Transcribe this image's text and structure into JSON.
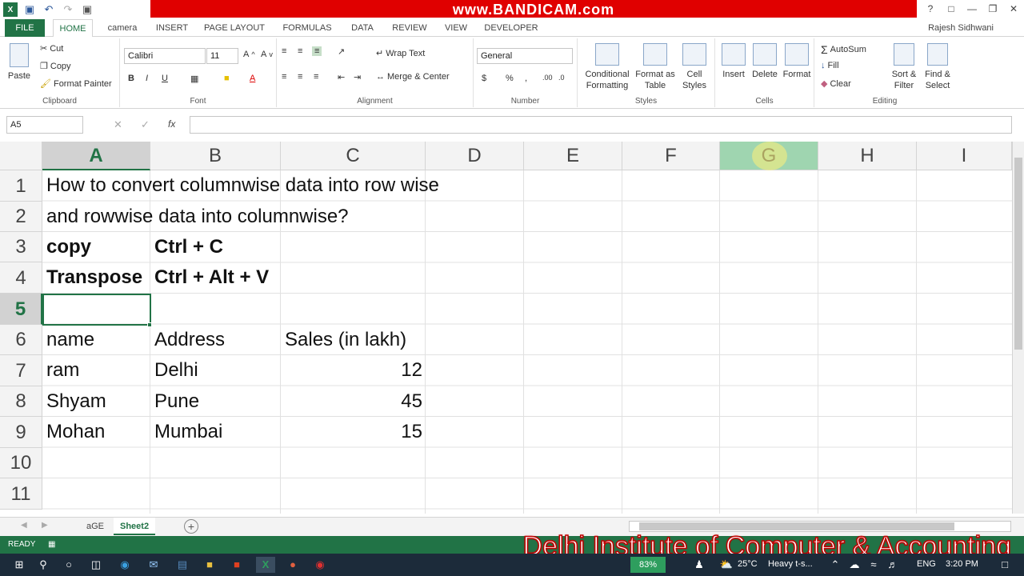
{
  "title_bar": {
    "recording_banner": "www.BANDICAM.com",
    "user": "Rajesh Sidhwani"
  },
  "tabs": [
    "FILE",
    "HOME",
    "camera",
    "INSERT",
    "PAGE LAYOUT",
    "FORMULAS",
    "DATA",
    "REVIEW",
    "VIEW",
    "DEVELOPER"
  ],
  "ribbon": {
    "clipboard": {
      "label": "Clipboard",
      "paste": "Paste",
      "cut": "Cut",
      "copy": "Copy",
      "format_painter": "Format Painter"
    },
    "font": {
      "label": "Font",
      "name": "Calibri",
      "size": "11"
    },
    "alignment": {
      "label": "Alignment",
      "wrap": "Wrap Text",
      "merge": "Merge & Center"
    },
    "number": {
      "label": "Number",
      "format": "General"
    },
    "styles": {
      "label": "Styles",
      "cond1": "Conditional",
      "cond2": "Formatting",
      "fmt1": "Format as",
      "fmt2": "Table",
      "cell1": "Cell",
      "cell2": "Styles"
    },
    "cells": {
      "label": "Cells",
      "insert": "Insert",
      "delete": "Delete",
      "format": "Format"
    },
    "editing": {
      "label": "Editing",
      "autosum": "AutoSum",
      "fill": "Fill",
      "clear": "Clear",
      "sort1": "Sort &",
      "sort2": "Filter",
      "find1": "Find &",
      "find2": "Select"
    }
  },
  "formula_bar": {
    "name_box": "A5",
    "fx": "fx",
    "content": ""
  },
  "columns": [
    "A",
    "B",
    "C",
    "D",
    "E",
    "F",
    "G",
    "H",
    "I"
  ],
  "rows": [
    "1",
    "2",
    "3",
    "4",
    "5",
    "6",
    "7",
    "8",
    "9",
    "10",
    "11"
  ],
  "cells": {
    "r1": "How to convert columnwise data into row wise",
    "r2": "and rowwise data into columnwise?",
    "a3": "copy",
    "b3": "Ctrl + C",
    "a4": "Transpose",
    "b4": "Ctrl + Alt +  V",
    "a6": "name",
    "b6": "Address",
    "c6": "Sales (in lakh)",
    "a7": "ram",
    "b7": "Delhi",
    "c7": "12",
    "a8": "Shyam",
    "b8": "Pune",
    "c8": "45",
    "a9": "Mohan",
    "b9": "Mumbai",
    "c9": "15"
  },
  "sheet_tabs": [
    "aGE",
    "Sheet2"
  ],
  "status": {
    "ready": "READY"
  },
  "watermark": "Delhi Institute of Computer & Accounting",
  "taskbar": {
    "battery": "83%",
    "temp": "25°C",
    "weather": "Heavy t-s...",
    "lang": "ENG",
    "time": "3:20 PM"
  }
}
